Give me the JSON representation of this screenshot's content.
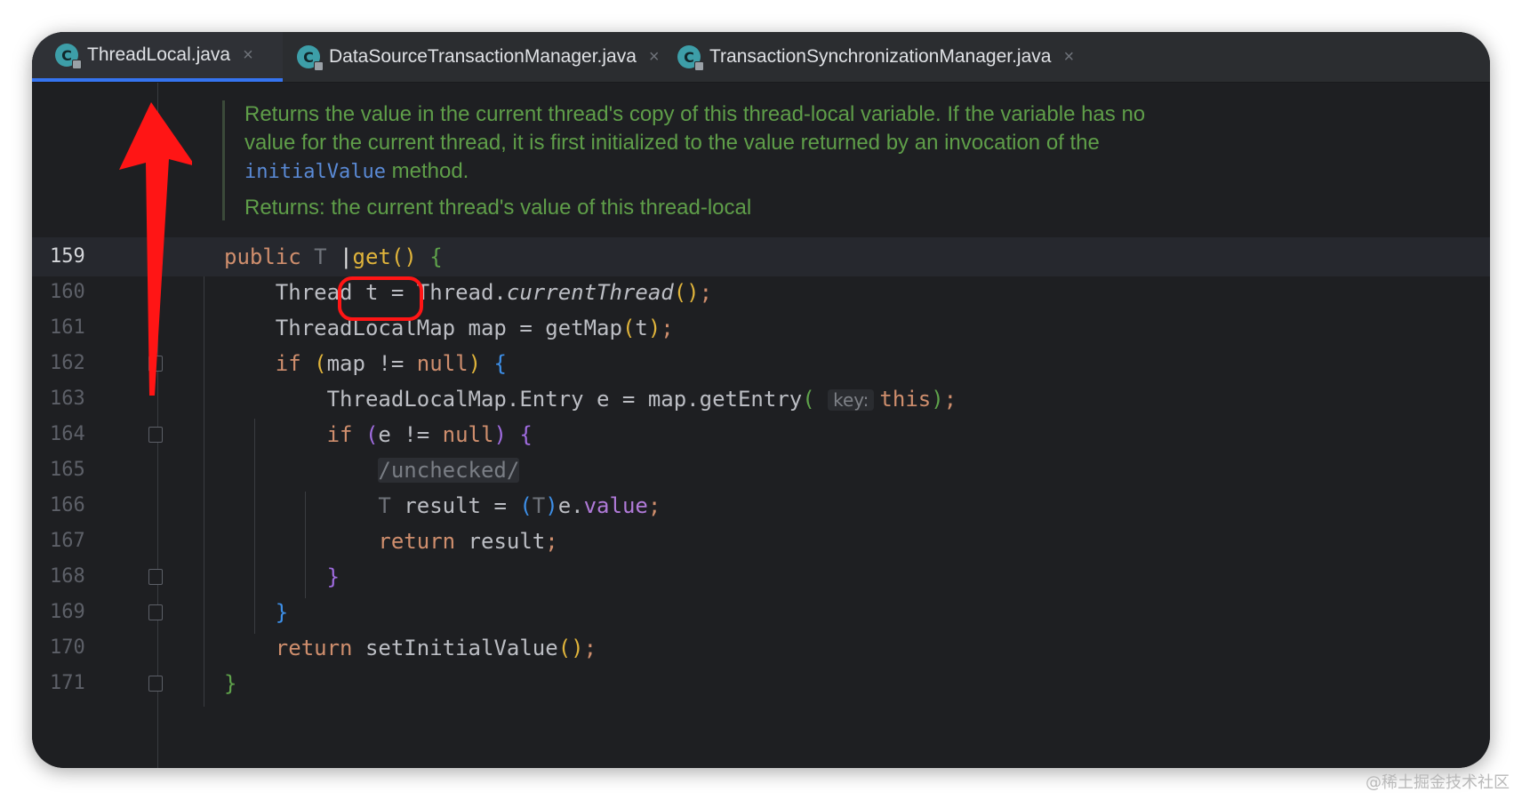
{
  "tabs": [
    {
      "icon": "C",
      "label": "ThreadLocal.java",
      "close": "×",
      "active": true
    },
    {
      "icon": "C",
      "label": "DataSourceTransactionManager.java",
      "close": "×",
      "active": false
    },
    {
      "icon": "C",
      "label": "TransactionSynchronizationManager.java",
      "close": "×",
      "active": false
    }
  ],
  "doc": {
    "line1": "Returns the value in the current thread's copy of this thread-local variable. If the variable has no",
    "line2": "value for the current thread, it is first initialized to the value returned by an invocation of the",
    "line3_code": "initialValue",
    "line3_rest": " method.",
    "returns": "Returns: the current thread's value of this thread-local"
  },
  "lines": [
    {
      "num": "159"
    },
    {
      "num": "160"
    },
    {
      "num": "161"
    },
    {
      "num": "162"
    },
    {
      "num": "163"
    },
    {
      "num": "164"
    },
    {
      "num": "165"
    },
    {
      "num": "166"
    },
    {
      "num": "167"
    },
    {
      "num": "168"
    },
    {
      "num": "169"
    },
    {
      "num": "170"
    },
    {
      "num": "171"
    }
  ],
  "code": {
    "l159": {
      "kw": "public",
      "type": "T",
      "method": "get",
      "parens": "()",
      "brace": "{"
    },
    "l160": {
      "a": "Thread t = Thread.",
      "b": "currentThread",
      "c": "()",
      "d": ";"
    },
    "l161": {
      "a": "ThreadLocalMap map = getMap",
      "b": "(",
      "c": "t",
      "d": ")",
      "e": ";"
    },
    "l162": {
      "kw": "if",
      "a": "(",
      "b": "map != ",
      "c": "null",
      "d": ")",
      "e": "{"
    },
    "l163": {
      "a": "ThreadLocalMap.Entry e = map.getEntry",
      "b": "(",
      "hint": "key:",
      "c": "this",
      "d": ")",
      "e": ";"
    },
    "l164": {
      "kw": "if",
      "a": "(",
      "b": "e != ",
      "c": "null",
      "d": ")",
      "e": "{"
    },
    "l165": {
      "comment": "/unchecked/"
    },
    "l166": {
      "type": "T",
      "a": " result = ",
      "b": "(",
      "c": "T",
      "d": ")",
      "e": "e.",
      "field": "value",
      "f": ";"
    },
    "l167": {
      "kw": "return",
      "a": " result",
      "b": ";"
    },
    "l168": {
      "brace": "}"
    },
    "l169": {
      "brace": "}"
    },
    "l170": {
      "kw": "return",
      "a": " setInitialValue",
      "b": "()",
      "c": ";"
    },
    "l171": {
      "brace": "}"
    }
  },
  "watermark": "@稀土掘金技术社区",
  "colors": {
    "annotation_red": "#ff1515",
    "accent_blue": "#3574f0"
  }
}
